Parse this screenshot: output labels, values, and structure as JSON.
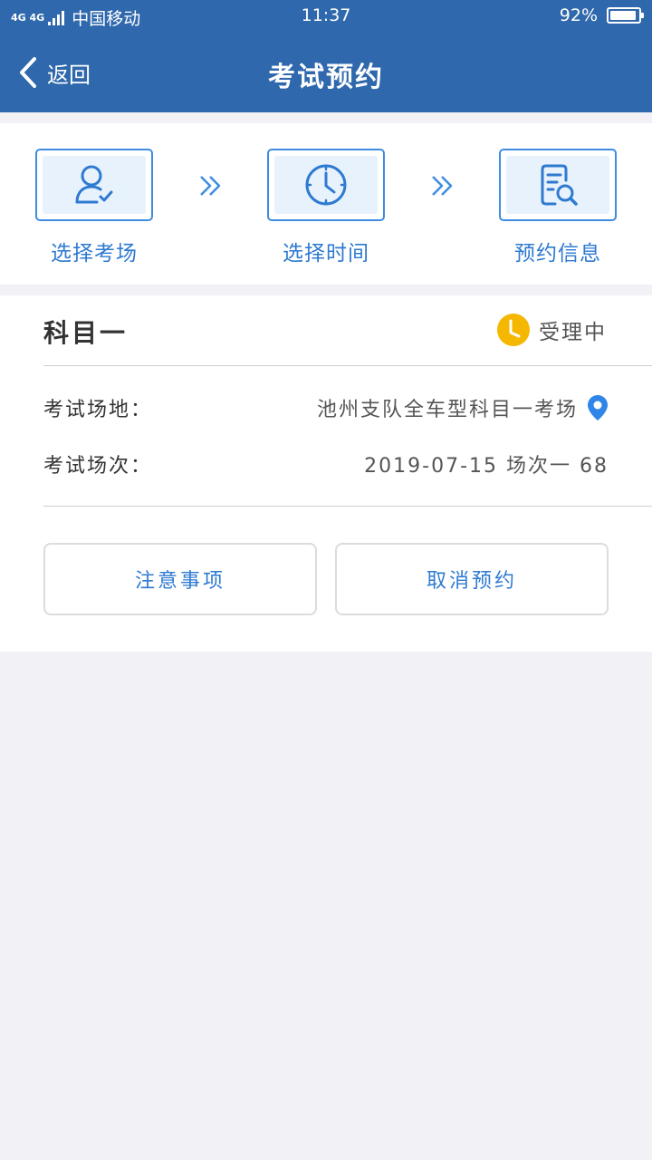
{
  "status_bar": {
    "network_top": "4G 4G",
    "carrier": "中国移动",
    "time": "11:37",
    "battery_text": "92%",
    "battery_level": 0.92
  },
  "nav": {
    "back_label": "返回",
    "title": "考试预约"
  },
  "steps": [
    {
      "label": "选择考场",
      "icon": "user-check-icon"
    },
    {
      "label": "选择时间",
      "icon": "clock-icon"
    },
    {
      "label": "预约信息",
      "icon": "document-search-icon"
    }
  ],
  "card": {
    "subject": "科目一",
    "status": "受理中",
    "venue_label": "考试场地：",
    "venue_value": "池州支队全车型科目一考场",
    "session_label": "考试场次：",
    "session_value": "2019-07-15 场次一 68",
    "notice_button": "注意事项",
    "cancel_button": "取消预约"
  },
  "colors": {
    "header_bg": "#2f68ac",
    "accent_blue": "#3e8de0",
    "status_yellow": "#f5b700",
    "page_bg": "#f2f2f6"
  }
}
